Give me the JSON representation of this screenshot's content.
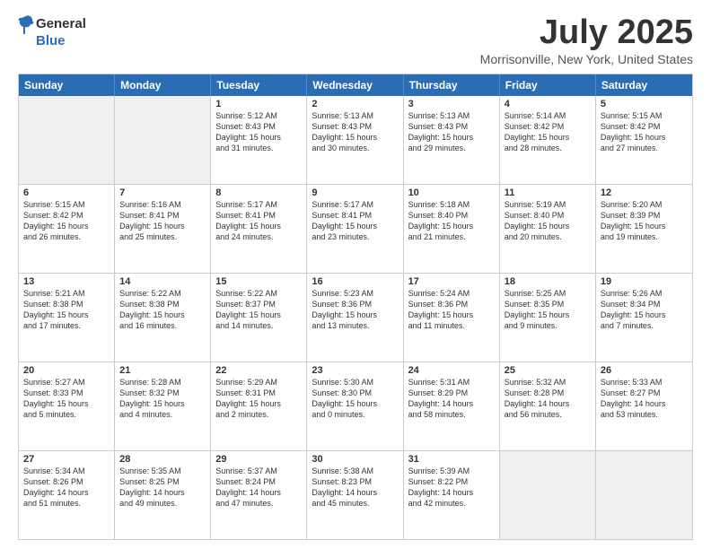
{
  "header": {
    "logo_line1": "General",
    "logo_line2": "Blue",
    "month": "July 2025",
    "location": "Morrisonville, New York, United States"
  },
  "days": [
    "Sunday",
    "Monday",
    "Tuesday",
    "Wednesday",
    "Thursday",
    "Friday",
    "Saturday"
  ],
  "rows": [
    [
      {
        "day": "",
        "info": ""
      },
      {
        "day": "",
        "info": ""
      },
      {
        "day": "1",
        "info": "Sunrise: 5:12 AM\nSunset: 8:43 PM\nDaylight: 15 hours\nand 31 minutes."
      },
      {
        "day": "2",
        "info": "Sunrise: 5:13 AM\nSunset: 8:43 PM\nDaylight: 15 hours\nand 30 minutes."
      },
      {
        "day": "3",
        "info": "Sunrise: 5:13 AM\nSunset: 8:43 PM\nDaylight: 15 hours\nand 29 minutes."
      },
      {
        "day": "4",
        "info": "Sunrise: 5:14 AM\nSunset: 8:42 PM\nDaylight: 15 hours\nand 28 minutes."
      },
      {
        "day": "5",
        "info": "Sunrise: 5:15 AM\nSunset: 8:42 PM\nDaylight: 15 hours\nand 27 minutes."
      }
    ],
    [
      {
        "day": "6",
        "info": "Sunrise: 5:15 AM\nSunset: 8:42 PM\nDaylight: 15 hours\nand 26 minutes."
      },
      {
        "day": "7",
        "info": "Sunrise: 5:16 AM\nSunset: 8:41 PM\nDaylight: 15 hours\nand 25 minutes."
      },
      {
        "day": "8",
        "info": "Sunrise: 5:17 AM\nSunset: 8:41 PM\nDaylight: 15 hours\nand 24 minutes."
      },
      {
        "day": "9",
        "info": "Sunrise: 5:17 AM\nSunset: 8:41 PM\nDaylight: 15 hours\nand 23 minutes."
      },
      {
        "day": "10",
        "info": "Sunrise: 5:18 AM\nSunset: 8:40 PM\nDaylight: 15 hours\nand 21 minutes."
      },
      {
        "day": "11",
        "info": "Sunrise: 5:19 AM\nSunset: 8:40 PM\nDaylight: 15 hours\nand 20 minutes."
      },
      {
        "day": "12",
        "info": "Sunrise: 5:20 AM\nSunset: 8:39 PM\nDaylight: 15 hours\nand 19 minutes."
      }
    ],
    [
      {
        "day": "13",
        "info": "Sunrise: 5:21 AM\nSunset: 8:38 PM\nDaylight: 15 hours\nand 17 minutes."
      },
      {
        "day": "14",
        "info": "Sunrise: 5:22 AM\nSunset: 8:38 PM\nDaylight: 15 hours\nand 16 minutes."
      },
      {
        "day": "15",
        "info": "Sunrise: 5:22 AM\nSunset: 8:37 PM\nDaylight: 15 hours\nand 14 minutes."
      },
      {
        "day": "16",
        "info": "Sunrise: 5:23 AM\nSunset: 8:36 PM\nDaylight: 15 hours\nand 13 minutes."
      },
      {
        "day": "17",
        "info": "Sunrise: 5:24 AM\nSunset: 8:36 PM\nDaylight: 15 hours\nand 11 minutes."
      },
      {
        "day": "18",
        "info": "Sunrise: 5:25 AM\nSunset: 8:35 PM\nDaylight: 15 hours\nand 9 minutes."
      },
      {
        "day": "19",
        "info": "Sunrise: 5:26 AM\nSunset: 8:34 PM\nDaylight: 15 hours\nand 7 minutes."
      }
    ],
    [
      {
        "day": "20",
        "info": "Sunrise: 5:27 AM\nSunset: 8:33 PM\nDaylight: 15 hours\nand 5 minutes."
      },
      {
        "day": "21",
        "info": "Sunrise: 5:28 AM\nSunset: 8:32 PM\nDaylight: 15 hours\nand 4 minutes."
      },
      {
        "day": "22",
        "info": "Sunrise: 5:29 AM\nSunset: 8:31 PM\nDaylight: 15 hours\nand 2 minutes."
      },
      {
        "day": "23",
        "info": "Sunrise: 5:30 AM\nSunset: 8:30 PM\nDaylight: 15 hours\nand 0 minutes."
      },
      {
        "day": "24",
        "info": "Sunrise: 5:31 AM\nSunset: 8:29 PM\nDaylight: 14 hours\nand 58 minutes."
      },
      {
        "day": "25",
        "info": "Sunrise: 5:32 AM\nSunset: 8:28 PM\nDaylight: 14 hours\nand 56 minutes."
      },
      {
        "day": "26",
        "info": "Sunrise: 5:33 AM\nSunset: 8:27 PM\nDaylight: 14 hours\nand 53 minutes."
      }
    ],
    [
      {
        "day": "27",
        "info": "Sunrise: 5:34 AM\nSunset: 8:26 PM\nDaylight: 14 hours\nand 51 minutes."
      },
      {
        "day": "28",
        "info": "Sunrise: 5:35 AM\nSunset: 8:25 PM\nDaylight: 14 hours\nand 49 minutes."
      },
      {
        "day": "29",
        "info": "Sunrise: 5:37 AM\nSunset: 8:24 PM\nDaylight: 14 hours\nand 47 minutes."
      },
      {
        "day": "30",
        "info": "Sunrise: 5:38 AM\nSunset: 8:23 PM\nDaylight: 14 hours\nand 45 minutes."
      },
      {
        "day": "31",
        "info": "Sunrise: 5:39 AM\nSunset: 8:22 PM\nDaylight: 14 hours\nand 42 minutes."
      },
      {
        "day": "",
        "info": ""
      },
      {
        "day": "",
        "info": ""
      }
    ]
  ]
}
